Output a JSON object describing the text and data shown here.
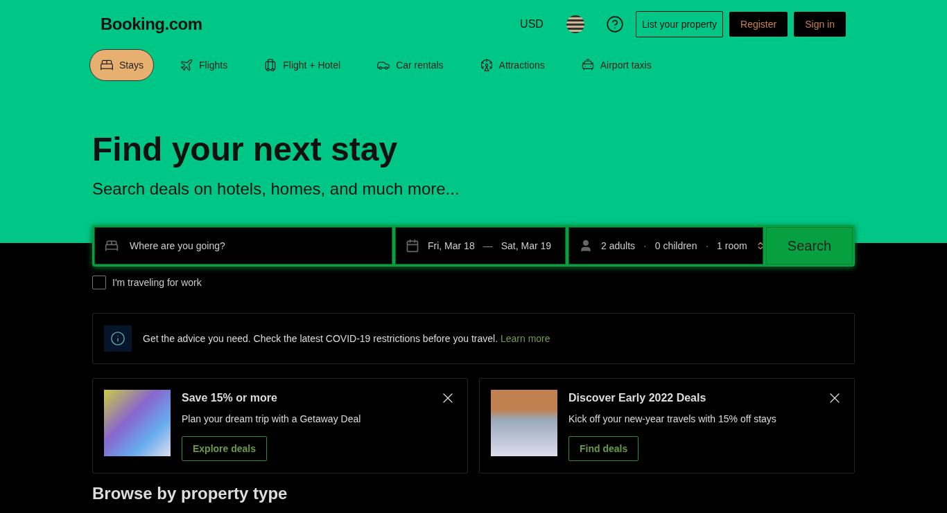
{
  "header": {
    "logo": "Booking.com",
    "currency": "USD",
    "buttons": [
      {
        "label": "List your property",
        "kind": "outline"
      },
      {
        "label": "Register",
        "kind": "solid"
      },
      {
        "label": "Sign in",
        "kind": "solid"
      }
    ]
  },
  "nav": [
    {
      "label": "Stays",
      "selected": true
    },
    {
      "label": "Flights",
      "selected": false
    },
    {
      "label": "Flight + Hotel",
      "selected": false
    },
    {
      "label": "Car rentals",
      "selected": false
    },
    {
      "label": "Attractions",
      "selected": false
    },
    {
      "label": "Airport taxis",
      "selected": false
    }
  ],
  "hero": {
    "title": "Find your next stay",
    "subtitle": "Search deals on hotels, homes, and much more..."
  },
  "search": {
    "destination": {
      "placeholder": "Where are you going?"
    },
    "check_in": "Fri, Mar 18",
    "separator": "—",
    "check_out": "Sat, Mar 19",
    "adults": "2 adults",
    "children": "0 children",
    "rooms": "1 room",
    "dot": "·",
    "button": "Search"
  },
  "work_travel": {
    "label": "I'm traveling for work",
    "checked": false
  },
  "notice": {
    "text": "Get the advice you need. Check the latest COVID-19 restrictions before you travel.",
    "link": "Learn more"
  },
  "promos": [
    {
      "title": "Save 15% or more",
      "text": "Plan your dream trip with a Getaway Deal",
      "button": "Explore deals"
    },
    {
      "title": "Discover Early 2022 Deals",
      "text": "Kick off your new-year travels with 15% off stays",
      "button": "Find deals"
    }
  ],
  "section_title": "Browse by property type"
}
